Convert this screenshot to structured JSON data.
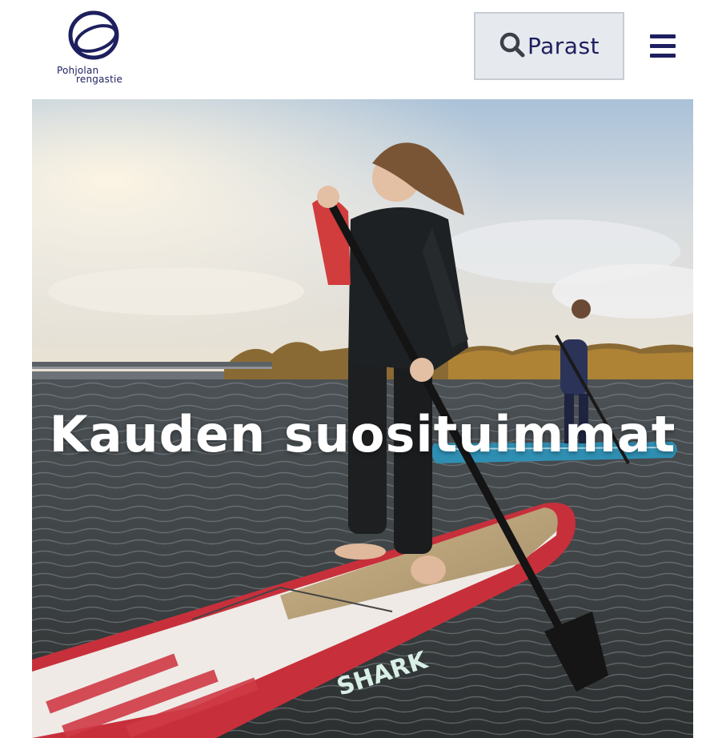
{
  "header": {
    "logo": {
      "name": "logo-icon",
      "line1": "Pohjolan",
      "line2": "rengastie"
    },
    "search": {
      "icon": "search-icon",
      "label": "Parast"
    },
    "menu": {
      "icon": "hamburger-menu-icon"
    }
  },
  "hero": {
    "title": "Kauden suosituimmat",
    "board_text": "SHARK"
  },
  "colors": {
    "brand": "#1e1f5e",
    "search_bg": "#e6e9ee"
  }
}
